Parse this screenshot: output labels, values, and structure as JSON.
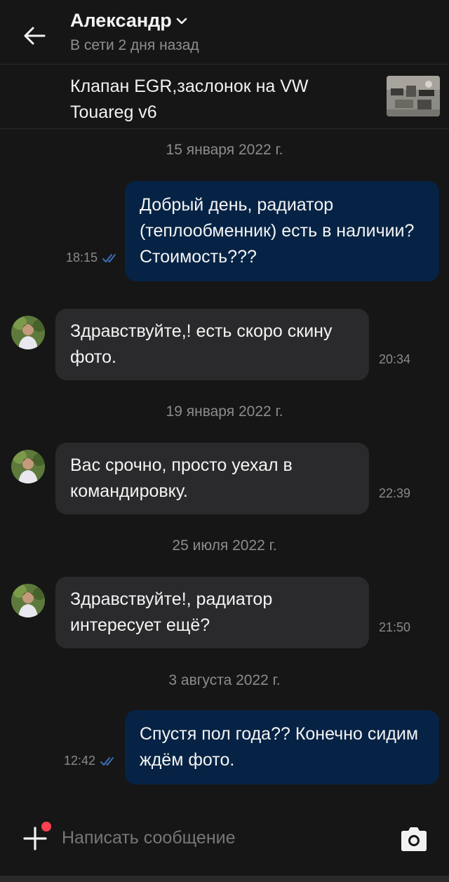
{
  "header": {
    "contact_name": "Александр",
    "status": "В сети 2 дня назад"
  },
  "listing": {
    "title": "Клапан EGR,заслонок на VW Touareg v6"
  },
  "messages": [
    {
      "date": "15 января 2022 г."
    },
    {
      "direction": "out",
      "text": "Добрый день, радиатор (теплообменник) есть в наличии? Стоимость???",
      "time": "18:15",
      "status_icon": "double-check-icon"
    },
    {
      "direction": "in",
      "text": "Здравствуйте,! есть скоро скину фото.",
      "time": "20:34"
    },
    {
      "date": "19 января 2022 г."
    },
    {
      "direction": "in",
      "text": "Вас срочно, просто уехал в командировку.",
      "time": "22:39"
    },
    {
      "date": "25 июля 2022 г."
    },
    {
      "direction": "in",
      "text": "Здравствуйте!, радиатор интересует ещё?",
      "time": "21:50"
    },
    {
      "date": "3 августа 2022 г."
    },
    {
      "direction": "out",
      "text": "Спустя пол года?? Конечно сидим ждём фото.",
      "time": "12:42",
      "status_icon": "double-check-icon"
    }
  ],
  "composer": {
    "placeholder": "Написать сообщение"
  },
  "colors": {
    "background": "#161616",
    "outgoing_bubble": "#062345",
    "incoming_bubble": "#2a2a2c",
    "read_check": "#3b6fb6",
    "notification_dot": "#ff4053"
  }
}
